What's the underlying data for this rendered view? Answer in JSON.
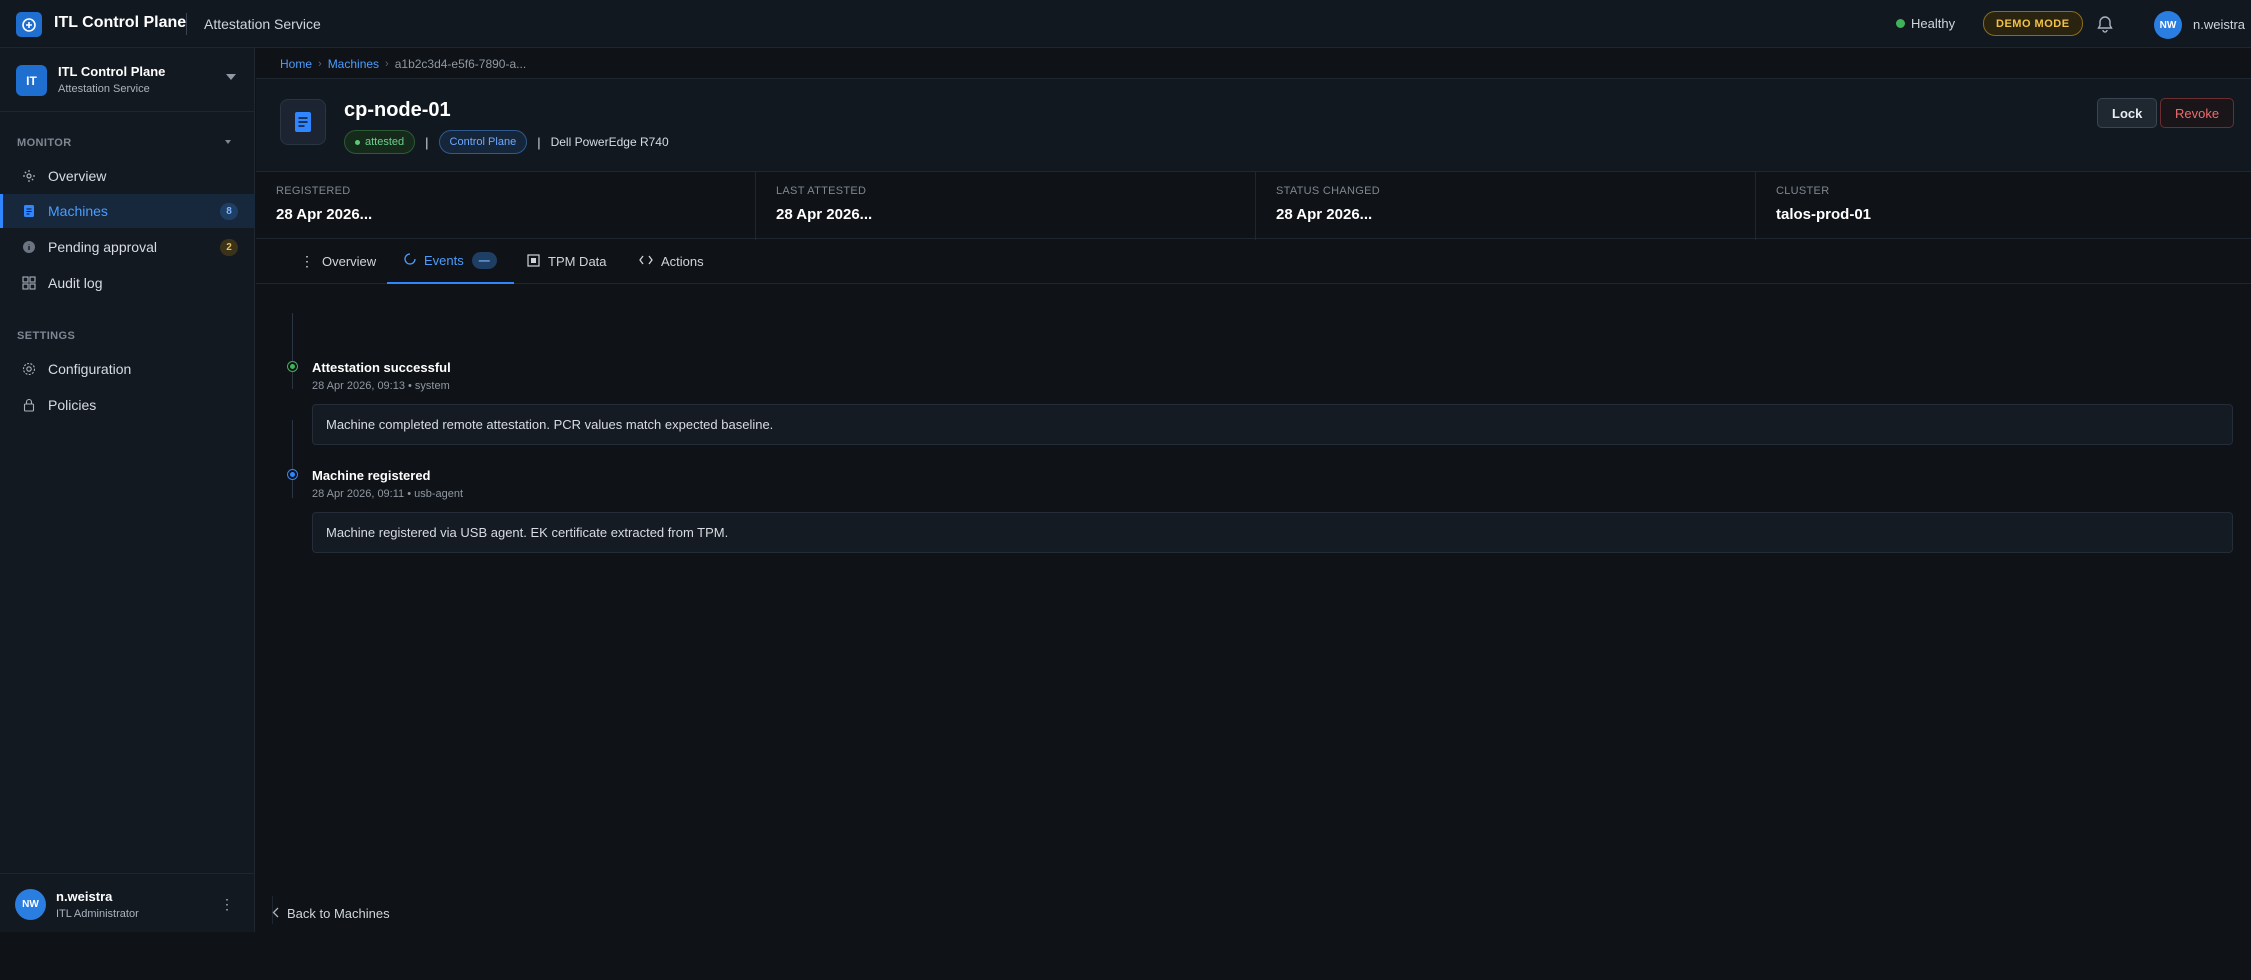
{
  "topbar": {
    "app_title": "ITL Control Plane",
    "service": "Attestation Service",
    "health": "Healthy",
    "demo_badge": "DEMO MODE",
    "user_initials": "NW",
    "user_name": "n.weistra",
    "accent": "#1f6fd1",
    "health_color": "#3fb35a"
  },
  "sidebar": {
    "org": {
      "initials": "IT",
      "name": "ITL Control Plane",
      "subtitle": "Attestation Service"
    },
    "sections": [
      {
        "label": "MONITOR",
        "items": [
          {
            "label": "Overview",
            "icon": "overview-icon",
            "active": false
          },
          {
            "label": "Machines",
            "icon": "machine-icon",
            "active": true,
            "badge": "8"
          },
          {
            "label": "Pending approval",
            "icon": "info-icon",
            "active": false,
            "badge": "2"
          },
          {
            "label": "Audit log",
            "icon": "grid-icon",
            "active": false
          }
        ]
      },
      {
        "label": "SETTINGS",
        "items": [
          {
            "label": "Configuration",
            "icon": "gear-icon",
            "active": false
          },
          {
            "label": "Policies",
            "icon": "lock-icon",
            "active": false
          }
        ]
      }
    ],
    "user": {
      "initials": "NW",
      "name": "n.weistra",
      "role": "ITL Administrator"
    }
  },
  "breadcrumb": {
    "home": "Home",
    "machines": "Machines",
    "current": "a1b2c3d4-e5f6-7890-a..."
  },
  "machine": {
    "name": "cp-node-01",
    "status": "attested",
    "role": "Control Plane",
    "sep": "|",
    "model": "Dell PowerEdge R740",
    "lock_label": "Lock",
    "revoke_label": "Revoke"
  },
  "stats": [
    {
      "label": "REGISTERED",
      "value": "28 Apr 2026..."
    },
    {
      "label": "LAST ATTESTED",
      "value": "28 Apr 2026..."
    },
    {
      "label": "STATUS CHANGED",
      "value": "28 Apr 2026..."
    },
    {
      "label": "CLUSTER",
      "value": "talos-prod-01"
    }
  ],
  "tabs": [
    {
      "label": "Overview",
      "icon": "kebab-icon",
      "active": false
    },
    {
      "label": "Events",
      "icon": "spinner-icon",
      "active": true,
      "count": "—"
    },
    {
      "label": "TPM Data",
      "icon": "chip-icon",
      "active": false
    },
    {
      "label": "Actions",
      "icon": "code-icon",
      "active": false
    }
  ],
  "events": [
    {
      "title": "Attestation successful",
      "meta": "28 Apr 2026, 09:13 • system",
      "detail": "Machine completed remote attestation. PCR values match expected baseline.",
      "color": "green"
    },
    {
      "title": "Machine registered",
      "meta": "28 Apr 2026, 09:11 • usb-agent",
      "detail": "Machine registered via USB agent. EK certificate extracted from TPM.",
      "color": "blue"
    }
  ],
  "back_label": "Back to Machines"
}
